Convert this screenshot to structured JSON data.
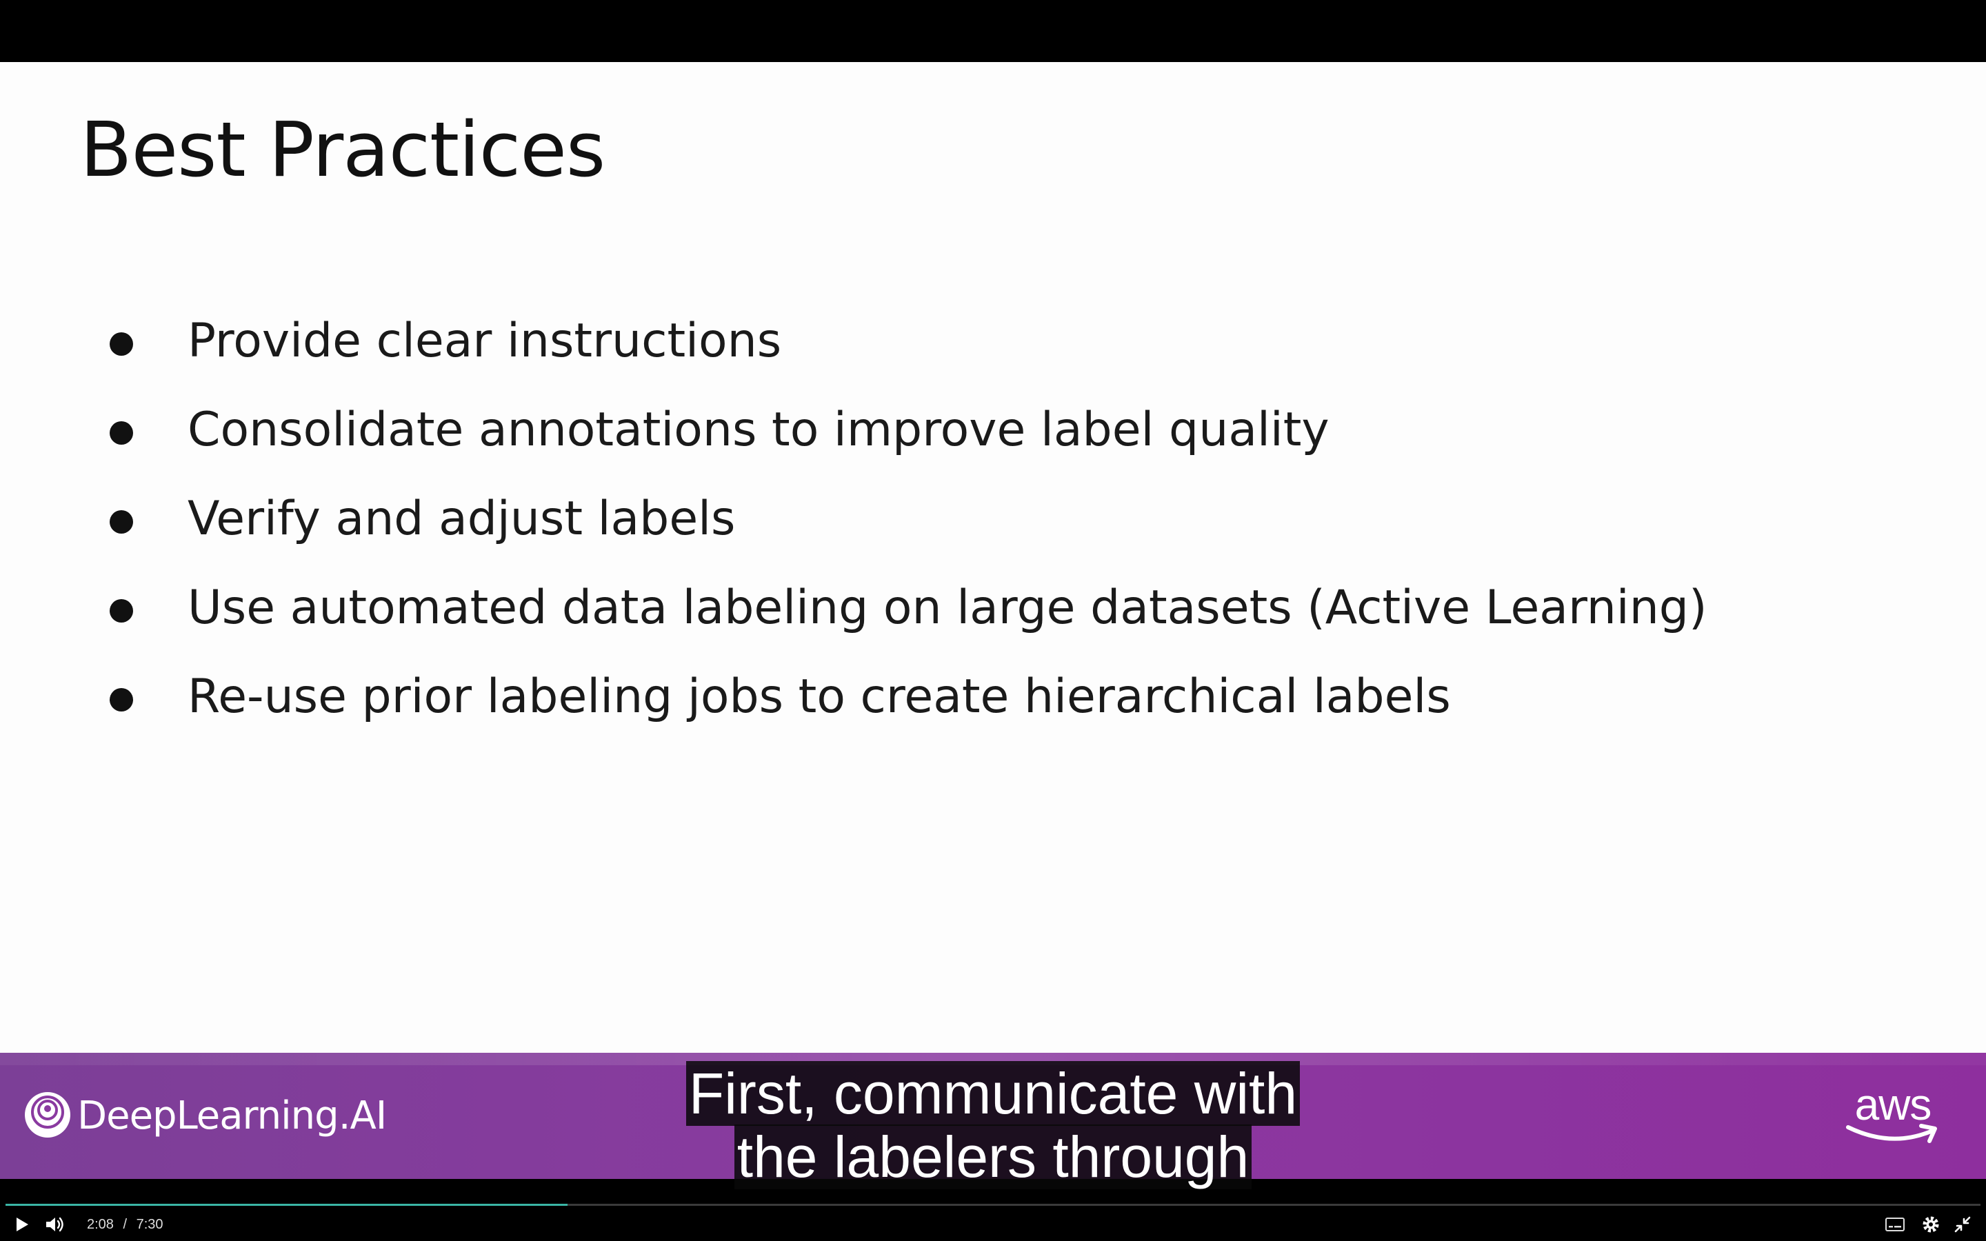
{
  "slide": {
    "title": "Best Practices",
    "bullets": [
      "Provide clear instructions",
      "Consolidate annotations to improve label quality",
      "Verify and adjust labels",
      "Use automated data labeling on large datasets (Active Learning)",
      "Re-use prior labeling jobs to create hierarchical labels"
    ]
  },
  "branding": {
    "left_brand": "DeepLearning.AI",
    "right_brand": "aws",
    "band_color": "#8a3aa0"
  },
  "captions": {
    "line1": "First, communicate with",
    "line2": "the labelers through"
  },
  "player": {
    "current_time": "2:08",
    "separator": "/",
    "duration": "7:30",
    "progress_fraction": 0.2844,
    "progress_color": "#3ab5a5",
    "icons": [
      "play-icon",
      "volume-icon",
      "captions-icon",
      "settings-icon",
      "exit-fullscreen-icon"
    ]
  }
}
